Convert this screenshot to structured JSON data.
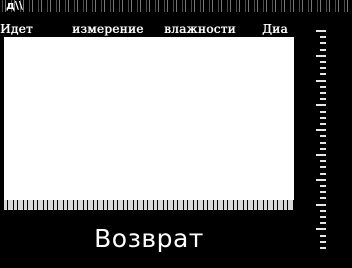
{
  "header": {
    "corner_mark": "д\\\\",
    "status_words": [
      "Идет",
      "измерение",
      "влажности",
      "Диа"
    ]
  },
  "panel": {
    "background": "#ffffff"
  },
  "actions": {
    "return_label": "Возврат"
  },
  "colors": {
    "background": "#000000",
    "text": "#ffffff"
  }
}
